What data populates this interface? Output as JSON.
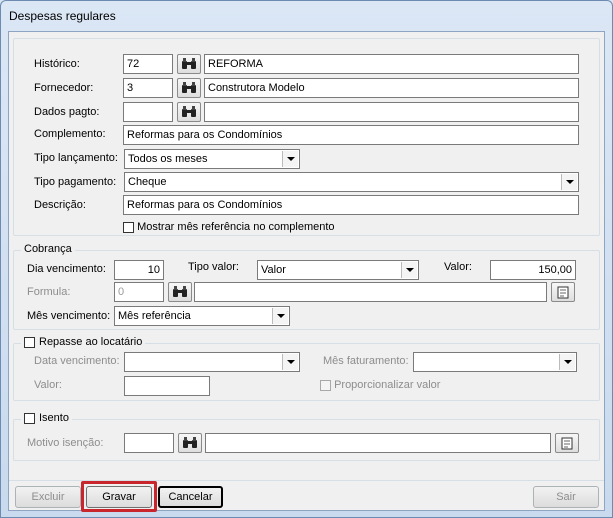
{
  "window": {
    "title": "Despesas regulares"
  },
  "main": {
    "historico": {
      "label": "Histórico:",
      "code": "72",
      "description": "REFORMA"
    },
    "fornecedor": {
      "label": "Fornecedor:",
      "code": "3",
      "description": "Construtora Modelo"
    },
    "dados_pagto": {
      "label": "Dados pagto:",
      "code": "",
      "description": ""
    },
    "complemento": {
      "label": "Complemento:",
      "value": "Reformas para os Condomínios"
    },
    "tipo_lancamento": {
      "label": "Tipo lançamento:",
      "value": "Todos os meses"
    },
    "tipo_pagamento": {
      "label": "Tipo pagamento:",
      "value": "Cheque"
    },
    "descricao": {
      "label": "Descrição:",
      "value": "Reformas para os Condomínios"
    },
    "mostrar_mes": {
      "label": "Mostrar mês referência no complemento",
      "checked": false
    }
  },
  "cobranca": {
    "legend": "Cobrança",
    "dia_vencimento": {
      "label": "Dia vencimento:",
      "value": "10"
    },
    "tipo_valor": {
      "label": "Tipo valor:",
      "value": "Valor"
    },
    "valor": {
      "label": "Valor:",
      "value": "150,00"
    },
    "formula": {
      "label": "Formula:",
      "code": "0",
      "description": ""
    },
    "mes_vencimento": {
      "label": "Mês vencimento:",
      "value": "Mês referência"
    }
  },
  "repasse": {
    "legend": "Repasse ao locatário",
    "checked": false,
    "data_vencimento": {
      "label": "Data vencimento:",
      "value": ""
    },
    "mes_faturamento": {
      "label": "Mês faturamento:",
      "value": ""
    },
    "valor": {
      "label": "Valor:",
      "value": ""
    },
    "proporcionalizar": {
      "label": "Proporcionalizar valor",
      "checked": false
    }
  },
  "isento": {
    "legend": "Isento",
    "checked": false,
    "motivo": {
      "label": "Motivo isenção:",
      "code": "",
      "description": ""
    }
  },
  "buttons": {
    "excluir": "Excluir",
    "gravar": "Gravar",
    "cancelar": "Cancelar",
    "sair": "Sair"
  },
  "colors": {
    "highlight": "#c8252c"
  }
}
